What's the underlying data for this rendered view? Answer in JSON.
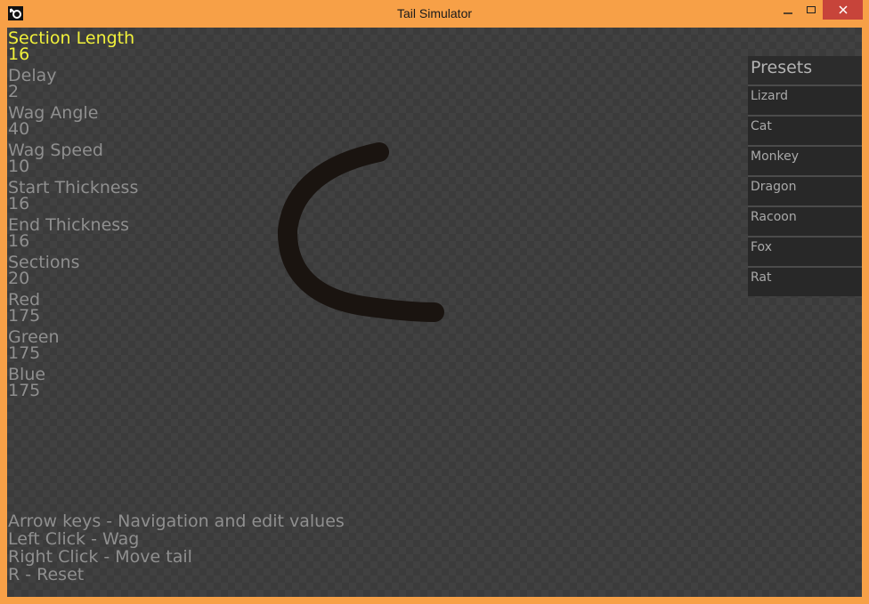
{
  "window": {
    "title": "Tail Simulator"
  },
  "params": [
    {
      "label": "Section Length",
      "value": "16",
      "selected": true
    },
    {
      "label": "Delay",
      "value": "2"
    },
    {
      "label": "Wag Angle",
      "value": "40"
    },
    {
      "label": "Wag Speed",
      "value": "10"
    },
    {
      "label": "Start Thickness",
      "value": "16"
    },
    {
      "label": "End Thickness",
      "value": "16"
    },
    {
      "label": "Sections",
      "value": "20"
    },
    {
      "label": "Red",
      "value": "175"
    },
    {
      "label": "Green",
      "value": "175"
    },
    {
      "label": "Blue",
      "value": "175"
    }
  ],
  "presets": {
    "title": "Presets",
    "items": [
      "Lizard",
      "Cat",
      "Monkey",
      "Dragon",
      "Racoon",
      "Fox",
      "Rat"
    ]
  },
  "help": [
    "Arrow keys - Navigation and edit values",
    "Left Click - Wag",
    "Right Click - Move tail",
    "R - Reset"
  ],
  "colors": {
    "frame": "#f7a047",
    "background": "#414141",
    "selected_text": "#f1f13a",
    "text": "#8f8f8f",
    "tail": "#1a1410"
  }
}
